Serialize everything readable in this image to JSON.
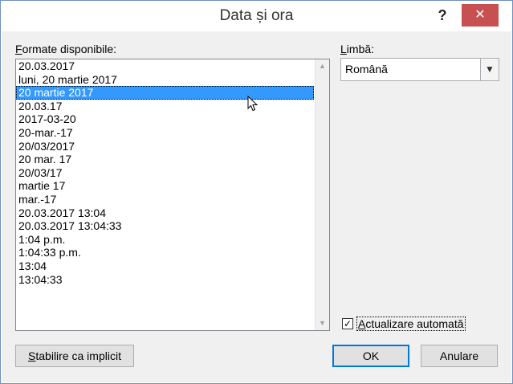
{
  "dialog": {
    "title": "Data și ora",
    "help_label": "?",
    "close_label": "✕"
  },
  "formats": {
    "label_underlined": "F",
    "label_rest": "ormate disponibile:",
    "items": [
      "20.03.2017",
      "luni, 20 martie 2017",
      "20 martie 2017",
      "20.03.17",
      "2017-03-20",
      "20-mar.-17",
      "20/03/2017",
      "20 mar. 17",
      "20/03/17",
      "martie 17",
      "mar.-17",
      "20.03.2017 13:04",
      "20.03.2017 13:04:33",
      "1:04 p.m.",
      "1:04:33 p.m.",
      "13:04",
      "13:04:33"
    ],
    "selected_index": 2
  },
  "language": {
    "label_underlined": "L",
    "label_rest": "imbă:",
    "value": "Română"
  },
  "auto_update": {
    "checked": true,
    "label_underlined": "A",
    "label_rest": "ctualizare automată"
  },
  "buttons": {
    "set_default_underlined": "S",
    "set_default_rest": "tabilire ca implicit",
    "ok": "OK",
    "cancel": "Anulare"
  },
  "icons": {
    "dropdown": "chevron-down-icon",
    "scroll_up": "scroll-up-icon",
    "scroll_down": "scroll-down-icon",
    "cursor": "mouse-pointer-icon"
  }
}
